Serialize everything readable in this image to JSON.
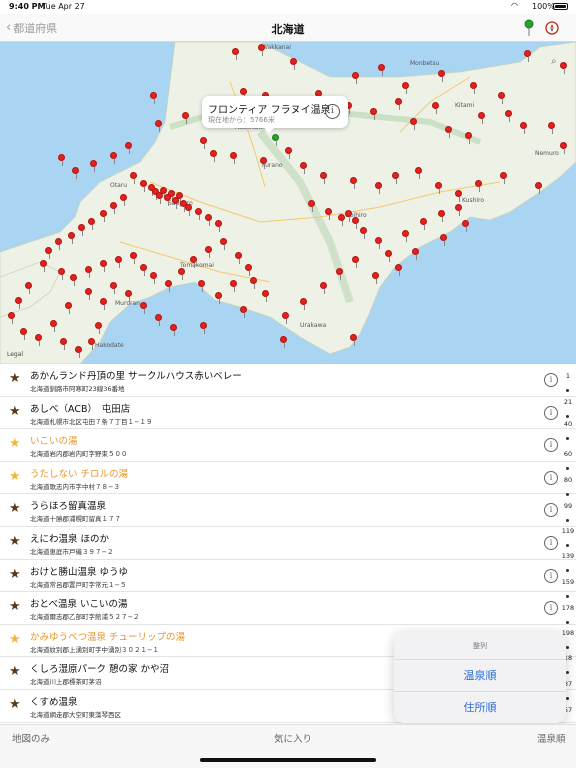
{
  "status": {
    "time": "9:40 PM",
    "date": "Tue Apr 27",
    "battery": "100%"
  },
  "nav": {
    "back_label": "都道府県",
    "title": "北海道"
  },
  "map": {
    "callout_title": "フロンティア フラヌイ温泉",
    "callout_subtitle": "現在地から：5766米",
    "legal": "Legal",
    "labels": [
      "Wakkanai",
      "Monbetsu",
      "Kitami",
      "Asahikawa",
      "Furano",
      "Sapporo",
      "Obihiro",
      "Kushiro",
      "Hakodate",
      "Tomakomai",
      "Muroran",
      "Otaru",
      "Urakawa",
      "Nemuro"
    ]
  },
  "rows": [
    {
      "name": "あかんランド丹頂の里 サークルハウス赤いベレー",
      "address": "北海道釧路市阿寒町23線36番地",
      "favorite": false
    },
    {
      "name": "あしべ（ACB）　屯田店",
      "address": "北海道札幌市北区屯田７条７丁目１−１９",
      "favorite": false
    },
    {
      "name": "いこいの湯",
      "address": "北海道岩内郡岩内町字野束５００",
      "favorite": true
    },
    {
      "name": "うたしない チロルの湯",
      "address": "北海道歌志内市字中村７８−３",
      "favorite": true
    },
    {
      "name": "うらほろ留真温泉",
      "address": "北海道十勝郡浦幌町留真１７７",
      "favorite": false
    },
    {
      "name": "えにわ温泉 ほのか",
      "address": "北海道恵庭市戸磯３９７−２",
      "favorite": false
    },
    {
      "name": "おけと勝山温泉 ゆうゆ",
      "address": "北海道常呂郡置戸町字常元１−５",
      "favorite": false
    },
    {
      "name": "おとべ温泉 いこいの湯",
      "address": "北海道爾志郡乙部町字館浦５２７−２",
      "favorite": false
    },
    {
      "name": "かみゆうべつ温泉 チューリップの湯",
      "address": "北海道紋別郡上湧別町字中湧別３０２１−１",
      "favorite": true
    },
    {
      "name": "くしろ湿原パーク 憩の家 かや沼",
      "address": "北海道川上郡標茶町茅沼",
      "favorite": false
    },
    {
      "name": "くすめ温泉",
      "address": "北海道網走郡大空町東藻琴西区",
      "favorite": false
    }
  ],
  "index": [
    "1",
    "21",
    "40",
    "60",
    "80",
    "99",
    "119",
    "139",
    "159",
    "178",
    "198",
    "18",
    "37",
    "57"
  ],
  "sort_popover": {
    "title": "整列",
    "option1": "温泉順",
    "option2": "住所順"
  },
  "toolbar": {
    "map_only": "地図のみ",
    "favorites": "気に入り",
    "sort": "温泉順"
  },
  "colors": {
    "accent": "#2f6fd6",
    "favorite": "#e8962a",
    "pin": "#e3211e",
    "water": "#a9d4f2",
    "land": "#eef2e6"
  }
}
